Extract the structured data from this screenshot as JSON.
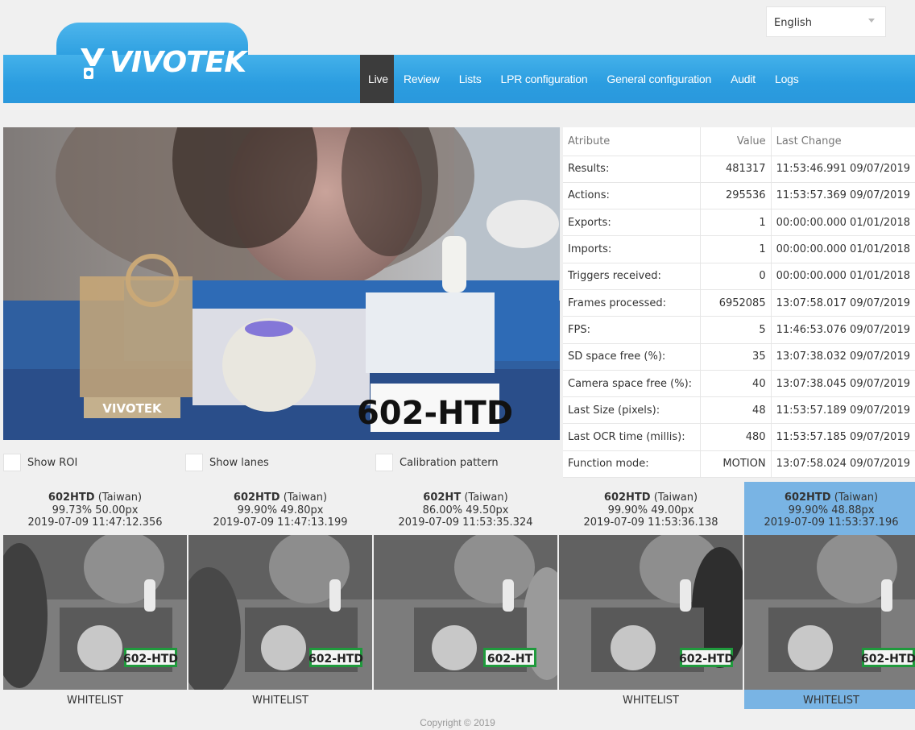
{
  "language": {
    "selected": "English"
  },
  "brand": {
    "name": "VIVOTEK"
  },
  "nav": {
    "items": [
      {
        "label": "Live",
        "active": true
      },
      {
        "label": "Review",
        "active": false
      },
      {
        "label": "Lists",
        "active": false
      },
      {
        "label": "LPR configuration",
        "active": false
      },
      {
        "label": "General configuration",
        "active": false
      },
      {
        "label": "Audit",
        "active": false
      },
      {
        "label": "Logs",
        "active": false
      }
    ]
  },
  "live": {
    "plate_text": "602-HTD",
    "sign_text": "VIVOTEK",
    "options": [
      {
        "label": "Show ROI",
        "checked": false
      },
      {
        "label": "Show lanes",
        "checked": false
      },
      {
        "label": "Calibration pattern",
        "checked": false
      }
    ]
  },
  "stats": {
    "headers": {
      "attribute": "Atribute",
      "value": "Value",
      "last_change": "Last Change"
    },
    "rows": [
      {
        "attribute": "Results:",
        "value": "481317",
        "last_change": "11:53:46.991 09/07/2019"
      },
      {
        "attribute": "Actions:",
        "value": "295536",
        "last_change": "11:53:57.369 09/07/2019"
      },
      {
        "attribute": "Exports:",
        "value": "1",
        "last_change": "00:00:00.000 01/01/2018"
      },
      {
        "attribute": "Imports:",
        "value": "1",
        "last_change": "00:00:00.000 01/01/2018"
      },
      {
        "attribute": "Triggers received:",
        "value": "0",
        "last_change": "00:00:00.000 01/01/2018"
      },
      {
        "attribute": "Frames processed:",
        "value": "6952085",
        "last_change": "13:07:58.017 09/07/2019"
      },
      {
        "attribute": "FPS:",
        "value": "5",
        "last_change": "11:46:53.076 09/07/2019"
      },
      {
        "attribute": "SD space free (%):",
        "value": "35",
        "last_change": "13:07:38.032 09/07/2019"
      },
      {
        "attribute": "Camera space free (%):",
        "value": "40",
        "last_change": "13:07:38.045 09/07/2019"
      },
      {
        "attribute": "Last Size (pixels):",
        "value": "48",
        "last_change": "11:53:57.189 09/07/2019"
      },
      {
        "attribute": "Last OCR time (millis):",
        "value": "480",
        "last_change": "11:53:57.185 09/07/2019"
      },
      {
        "attribute": "Function mode:",
        "value": "MOTION",
        "last_change": "13:07:58.024 09/07/2019"
      }
    ]
  },
  "detections": [
    {
      "plate": "602HTD",
      "country": "(Taiwan)",
      "metrics": "99.73% 50.00px",
      "time": "2019-07-09 11:47:12.356",
      "list": "WHITELIST",
      "thumb_plate": "602-HTD",
      "selected": false
    },
    {
      "plate": "602HTD",
      "country": "(Taiwan)",
      "metrics": "99.90% 49.80px",
      "time": "2019-07-09 11:47:13.199",
      "list": "WHITELIST",
      "thumb_plate": "602-HTD",
      "selected": false
    },
    {
      "plate": "602HT",
      "country": "(Taiwan)",
      "metrics": "86.00% 49.50px",
      "time": "2019-07-09 11:53:35.324",
      "list": "",
      "thumb_plate": "602-HT",
      "selected": false
    },
    {
      "plate": "602HTD",
      "country": "(Taiwan)",
      "metrics": "99.90% 49.00px",
      "time": "2019-07-09 11:53:36.138",
      "list": "WHITELIST",
      "thumb_plate": "602-HTD",
      "selected": false
    },
    {
      "plate": "602HTD",
      "country": "(Taiwan)",
      "metrics": "99.90% 48.88px",
      "time": "2019-07-09 11:53:37.196",
      "list": "WHITELIST",
      "thumb_plate": "602-HTD",
      "selected": true
    }
  ],
  "footer": {
    "copyright": "Copyright © 2019"
  },
  "colors": {
    "nav_blue": "#2b9de0",
    "active_tab": "#3c3c3c",
    "selected_detection": "#79b4e4",
    "plate_green": "#1f9a3c"
  }
}
